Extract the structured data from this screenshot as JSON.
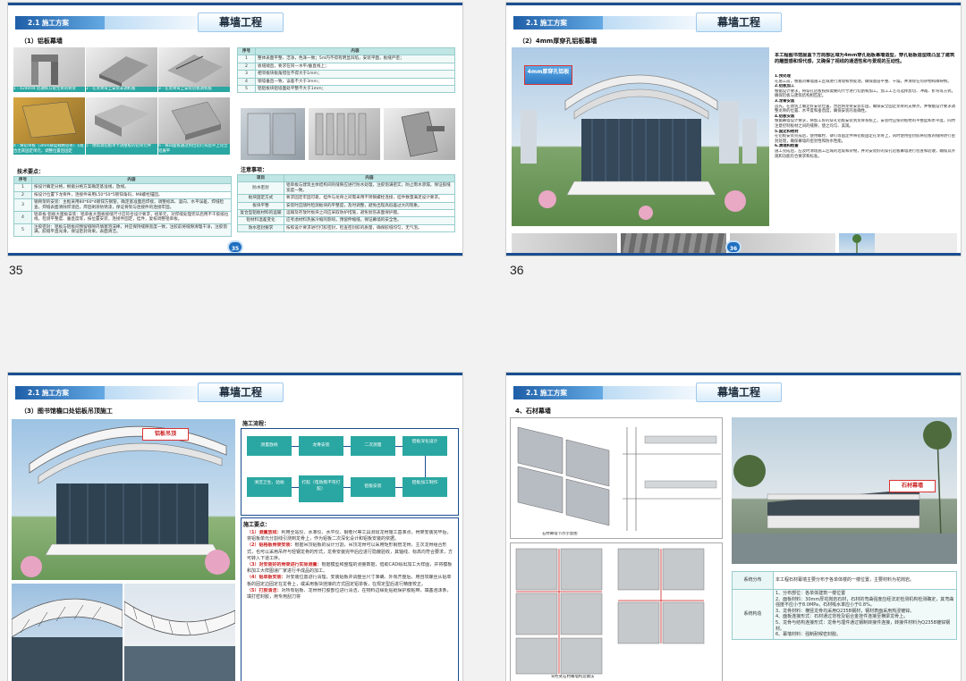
{
  "pages": [
    {
      "number_label": "35",
      "page_num": "35",
      "section": "2.1 施工方案",
      "title": "幕墙工程",
      "subtitle": "（1）铝板幕墙",
      "photos": [
        {
          "caption": "1 - 4240H4 铝通样方管无骨的骨架"
        },
        {
          "caption": "2 - 在龙骨背上安装非调机板"
        },
        {
          "caption": "3 - 在龙骨背上安装铝板调机板"
        },
        {
          "caption": "4 - 将铝单板（3mm厚度规格铝条）1组合出来固定单元，调整位置后固定"
        },
        {
          "caption": "5 - 继续调铝板单卡调整板的铝单元件"
        },
        {
          "caption": "6 - 将四面板通过到位铝行块后平上完全铝展平"
        }
      ],
      "tech_title": "技术要点：",
      "tech_headers": [
        "序号",
        "内容"
      ],
      "tech_rows": [
        [
          "1",
          "按设计确定分格，根据分格方案确定基准线，放线。"
        ],
        [
          "2",
          "按设计位置下龙骨件，连接件采用L50*50*5镀锌角码，M8螺栓锚固。"
        ],
        [
          "3",
          "钢骨架的安装：主框采用80*60*4镀锌方钢管，确定基准面后焊接，调整标高、竖向、水平误差，焊缝检查，焊缝表面清除焊渣后，焊后刷涂防锈漆，保证骨架与连接件的连接牢固。"
        ],
        [
          "4",
          "铝单板·铝板大面板安装：铝单板大面板接缝尺寸应符合设计要求，组单元，对焊缝处理完毕后用不干胶纸拉线，检测平整度、垂直度等，按位置安装，连接件固定，挂件，复核调整铝单板。"
        ],
        [
          "5",
          "注胶密封：铝板与铝板间预留缝隙内填塞泡沫棒，并应保持缝隙宽度一致，注胶前将缝隙清理干净，注胶饱满，胶缝平直光滑，保证密封效果。表面清洁。"
        ]
      ],
      "std_headers": [
        "序号",
        "内容"
      ],
      "std_rows": [
        [
          "1",
          "整体表面平整、洁净，色泽一致；5m内不得有明显凹陷，安装平面，板缝严密；"
        ],
        [
          "2",
          "板缝顺直，要求在同一水平/垂直线上；"
        ],
        [
          "3",
          "相邻板块板角错位不得大于1mm；"
        ],
        [
          "4",
          "钢墙垂直一致，误差不大于3mm；"
        ],
        [
          "5",
          "铝铝板块铝墙面处平整不大于1mm；"
        ]
      ],
      "note_title": "注意事项：",
      "note_headers": [
        "项目",
        "内容"
      ],
      "note_rows": [
        [
          "防水密封",
          "铝单板与建筑主体结构间的缝隙应进行防水处理，注胶饱满密实，防止雨水渗漏，保证胶缝宽度一致。"
        ],
        [
          "板块固定方式",
          "要求固定牢固可靠，挂件与龙骨之间需采用不锈钢螺栓连接，挂件数量满足设计要求。"
        ],
        [
          "板块平整",
          "安装时应随时检测板块的平整度，及时调整，避免出现高低差过大的现象。"
        ],
        [
          "复合型铝板材料的运输",
          "运输及存放时板块之间应采取防护措施，避免划伤表面保护膜。"
        ],
        [
          "铝材料温差变化",
          "应考虑材料热胀冷缩的影响，预留伸缩缝，保证幕墙的安全性。"
        ],
        [
          "防水密封要求",
          "按照设计要求进行打胶密封，检查密封胶的质量，确保胶缝均匀，无气泡。"
        ]
      ]
    },
    {
      "number_label": "36",
      "page_num": "36",
      "section": "2.1 施工方案",
      "title": "幕墙工程",
      "subtitle": "（2）4mm厚穿孔铝板幕墙",
      "tag": "4mm厚穿孔铝板",
      "intro": "本工程图书馆屋盖下方局部区域为4mm穿孔铝板幕墙造型，穿孔铝板造型既凸显了建筑的雕塑感和现代感，又确保了视线的通透性和与景观的互动性。",
      "steps": [
        {
          "head": "1.预处理",
          "body": "在施工前，根据对幕墙施工区域进行清理和预处理，确保基层平整、干燥，并清除任何杂物和障碍物。"
        },
        {
          "head": "2.铝板加工",
          "body": "根据设计要求，将穿孔铝板按照需要的尺寸进行切割和加工。加工工艺可选择剪切、冲裁、折弯等方式，确保铝板与建筑结构相匹配。"
        },
        {
          "head": "3.龙骨安装",
          "body": "首先，在建筑上确定好安装位置，然后将龙骨安装牢固，确保安全固定龙骨的支撑点，并根据设计要求调整龙骨的位置、水平度和垂直度，确保安装的准确性。"
        },
        {
          "head": "4.铝板安装",
          "body": "根据幕墙设计要求，将加工好的穿孔铝板安装到龙骨系统上，安装时应保持板材的平整度和水平度，同时注意控制板材之间的缝隙，使之均匀、美观。"
        },
        {
          "head": "5.固定和密封",
          "body": "在铝板安装完成后，使用螺栓、铆钉等固定件将铝板固定在龙骨上，同时使用密封胶将铝板的缝隙进行密封处理，确保幕墙的密封性和防水性能。"
        },
        {
          "head": "6.清理和检查",
          "body": "施工完成后，应及时清理施工区域的垃圾和杂物，并对安装好的穿孔铝板幕墙进行检查和验收，确保其外观和功能符合要求和标准。"
        }
      ]
    },
    {
      "number_label": "",
      "page_num": "",
      "section": "2.1 施工方案",
      "title": "幕墙工程",
      "subtitle": "（3）图书馆檐口处铝板吊顶施工",
      "tag": "铝板吊顶",
      "flow_title": "施工流程：",
      "flow": [
        "测量放线",
        "龙骨安装",
        "二次测量",
        "铝板深化设计",
        "铝板加工制作",
        "铝板安装",
        "打胶（电防雨不符打胶）",
        "清洁卫生、验收"
      ],
      "key_title": "施工要点：",
      "keys": [
        {
          "head": "（1）测量放线：",
          "body": "利用全站仪、水准仪、水平仪、钢卷尺等工具测出龙骨施工基准点，骨架安装完毕后，将铝板单元分割线引测到龙骨上，作为铝板二次深化设计和铝板安装的依据。"
        },
        {
          "head": "（2）铝格板骨架安装：",
          "body": "根据吊顶铝板的设计分割，吊顶龙骨可以采用矩形钢管龙骨，主次龙骨组合形式，也可以采用吊杆与轻钢龙骨的形式，龙骨安装完毕后应进行隐蔽验收，其轴线、标高均符合要求，方可转入下道工序。"
        },
        {
          "head": "（3）对安装好的骨架进行实际测量：",
          "body": "根据模型和整理的测量数据，借助CAD绘出加工大样图，并将模板和加工大样图递厂家进行半成品的加工。"
        },
        {
          "head": "（4）铝单板安装：",
          "body": "对安装位置进行清理，安装铝板并调整至尺寸准确、外观齐整后，用自攻螺丝从铝单板的固定边固定在龙骨上，或采用板块挂接的方式固定铝单板，在规定型后进行精度校正。"
        },
        {
          "head": "（5）打胶清洁：",
          "body": "对所有铝板、龙骨骨打胶部位进行清洁，在物料边缘处贴纸保护胶粘带，填塞泡沫条，填打密封胶，用专用刮刀将"
        }
      ]
    },
    {
      "number_label": "",
      "page_num": "",
      "section": "2.1 施工方案",
      "title": "幕墙工程",
      "subtitle": "4、石材幕墙",
      "tag": "石材幕墙",
      "diag_captions": [
        "石材幕墙节点示意图",
        "背栓式石材幕墙构造做法"
      ],
      "rows": [
        {
          "label": "系统分布",
          "text": "本工程石材幕墙主要分布于各单体楼的一楼位置，主要材料为花岗岩。"
        },
        {
          "label": "系统构造",
          "lines": [
            "1、分布部位：各单体建筑一楼位置",
            "2、面板材料：30mm厚花岗岩石材，石材的弯曲强度应经法定检测机构检测确定，其弯曲强度不应小于8.0MPa，石材吸水率应小于0.8%。",
            "3、龙骨材料：横竖龙骨均采用Q235B钢材，钢材表面采用热浸镀锌。",
            "4、面板连接形式：石材通过背栓及铝合金挂件连接至横梁龙骨上。",
            "5、龙骨与结构连接形式：龙骨与埋件通过钢制转接件连接，转接件材料为Q235B镀锌钢材。",
            "6、幕墙材料：强制耐候密封胶。"
          ]
        }
      ]
    }
  ],
  "colors": {
    "header": "#1a4e8f",
    "teal": "#2aa7a2",
    "red_tag": "#d33"
  }
}
